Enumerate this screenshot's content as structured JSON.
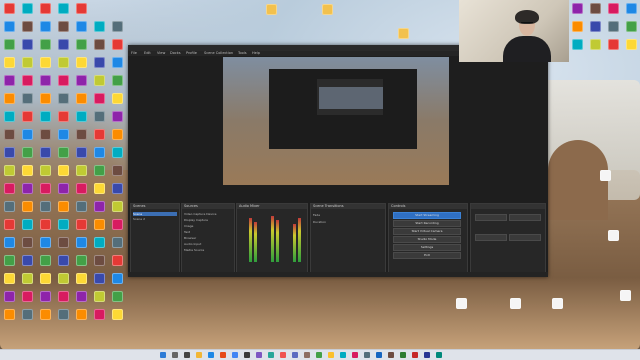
{
  "obs": {
    "title": "",
    "menu": [
      "File",
      "Edit",
      "View",
      "Docks",
      "Profile",
      "Scene Collection",
      "Tools",
      "Help"
    ],
    "panels": {
      "scenes": {
        "header": "Scenes",
        "items": [
          "Scene",
          "Scene 2"
        ]
      },
      "sources": {
        "header": "Sources",
        "items": [
          "Video Capture Device",
          "Display Capture",
          "Image",
          "Text",
          "Browser",
          "Audio Input",
          "Media Source"
        ]
      },
      "mixer": {
        "header": "Audio Mixer"
      },
      "transitions": {
        "header": "Scene Transitions",
        "items": [
          "Fade",
          "Duration"
        ]
      },
      "controls": {
        "header": "Controls",
        "buttons": [
          "Start Streaming",
          "Start Recording",
          "Start Virtual Camera",
          "Studio Mode",
          "Settings",
          "Exit"
        ]
      }
    },
    "status": ""
  },
  "taskbar": {
    "time": ""
  },
  "colors": {
    "accent": "#2f6fc2",
    "meter_green": "#2f9e3c",
    "obs_bg": "#1e1e1e"
  }
}
